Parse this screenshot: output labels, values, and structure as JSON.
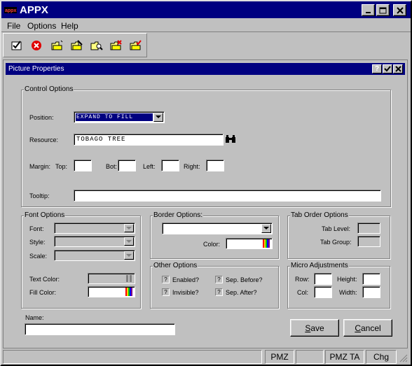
{
  "app": {
    "title": "APPX"
  },
  "menu": [
    "File",
    "Options",
    "Help"
  ],
  "toolbar": [
    "ok-check-icon",
    "cancel-icon",
    "folder-new-icon",
    "folder-edit-icon",
    "folder-search-icon",
    "folder-delete-icon",
    "folder-check-icon"
  ],
  "dialog": {
    "title": "Picture Properties",
    "help_label": "?"
  },
  "control_options": {
    "legend": "Control Options",
    "position_label": "Position:",
    "position_value": "EXPAND TO FILL",
    "resource_label": "Resource:",
    "resource_value": "TOBAGO TREE",
    "margin_label": "Margin:",
    "top_label": "Top:",
    "bot_label": "Bot:",
    "left_label": "Left:",
    "right_label": "Right:",
    "tooltip_label": "Tooltip:"
  },
  "font_options": {
    "legend": "Font Options",
    "font_label": "Font:",
    "style_label": "Style:",
    "scale_label": "Scale:",
    "text_color_label": "Text Color:",
    "fill_color_label": "Fill Color:"
  },
  "border_options": {
    "legend": "Border Options:",
    "color_label": "Color:"
  },
  "other_options": {
    "legend": "Other Options",
    "enabled_label": "Enabled?",
    "invisible_label": "Invisible?",
    "sep_before_label": "Sep. Before?",
    "sep_after_label": "Sep. After?",
    "check_glyph": "?"
  },
  "tab_order": {
    "legend": "Tab Order Options",
    "tab_level_label": "Tab Level:",
    "tab_group_label": "Tab Group:"
  },
  "micro": {
    "legend": "Micro Adjustments",
    "row_label": "Row:",
    "col_label": "Col:",
    "height_label": "Height:",
    "width_label": "Width:"
  },
  "name_label": "Name:",
  "buttons": {
    "save": "Save",
    "cancel": "Cancel"
  },
  "status": [
    "PMZ",
    "PMZ TA",
    "Chg"
  ],
  "colors": {
    "title_bar": "#000080",
    "face": "#c0c0c0",
    "position_highlight": "#000080"
  }
}
